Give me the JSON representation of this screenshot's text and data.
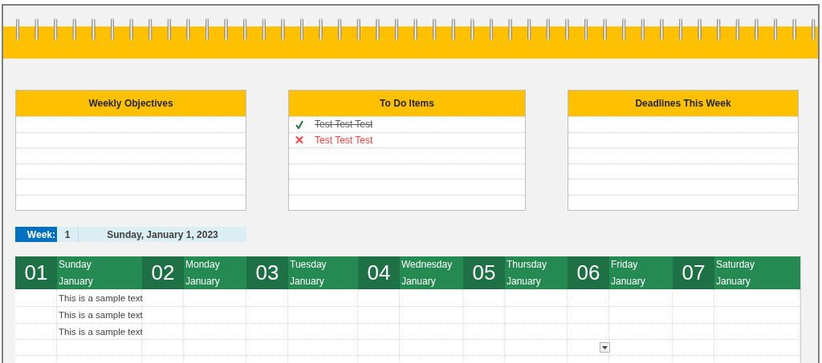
{
  "panels": [
    {
      "title": "Weekly Objectives"
    },
    {
      "title": "To Do Items",
      "items": [
        {
          "text": "Test Test Test",
          "checked": true
        },
        {
          "text": "Test Test Test",
          "checked": false
        }
      ]
    },
    {
      "title": "Deadlines This Week"
    }
  ],
  "week": {
    "label": "Week:",
    "number": "1",
    "date": "Sunday, January 1, 2023"
  },
  "days": [
    {
      "number": "01",
      "weekday": "Sunday",
      "month": "January",
      "entries": [
        "This is a sample text",
        "This is a sample text",
        "This is a sample text"
      ],
      "dropdown": false
    },
    {
      "number": "02",
      "weekday": "Monday",
      "month": "January",
      "dropdown": false
    },
    {
      "number": "03",
      "weekday": "Tuesday",
      "month": "January",
      "dropdown": false
    },
    {
      "number": "04",
      "weekday": "Wednesday",
      "month": "January",
      "dropdown": false
    },
    {
      "number": "05",
      "weekday": "Thursday",
      "month": "January",
      "dropdown": false
    },
    {
      "number": "06",
      "weekday": "Friday",
      "month": "January",
      "dropdown": true
    },
    {
      "number": "07",
      "weekday": "Saturday",
      "month": "January",
      "dropdown": false
    }
  ]
}
